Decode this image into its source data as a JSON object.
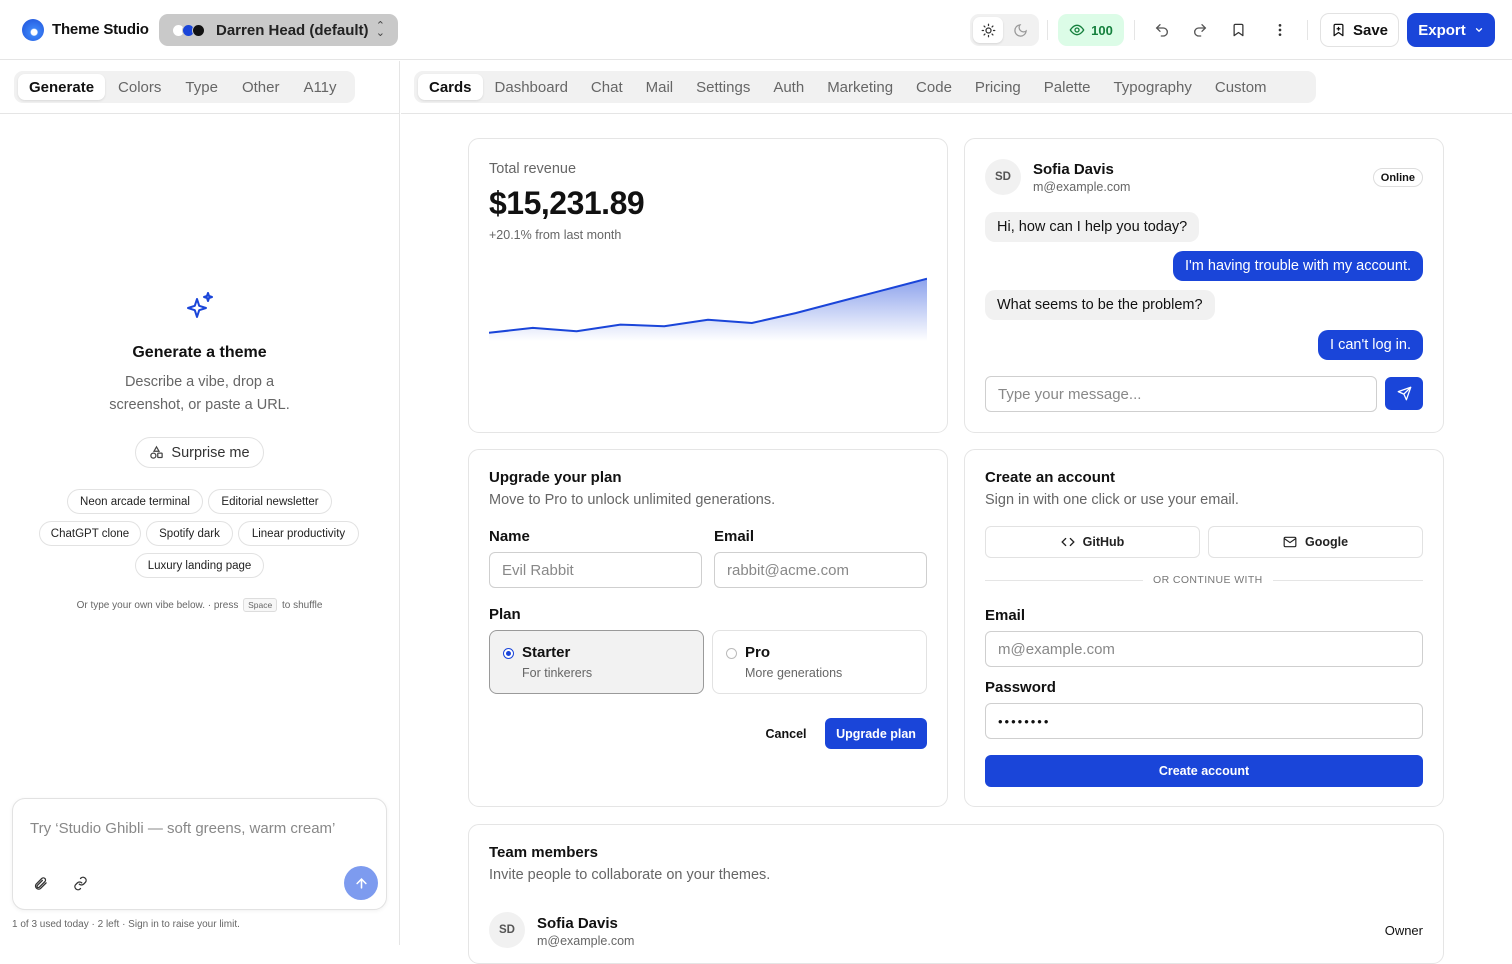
{
  "app": {
    "title": "Theme Studio"
  },
  "theme_selector": {
    "label": "Darren Head (default)",
    "swatch_colors": [
      "#ffffff",
      "#1a45d9",
      "#111111"
    ]
  },
  "header": {
    "score": "100",
    "save_label": "Save",
    "export_label": "Export",
    "icons": [
      "sun-icon",
      "moon-icon",
      "eye-icon",
      "undo-icon",
      "redo-icon",
      "bookmark-icon",
      "more-vertical-icon",
      "bookmark-plus-icon",
      "chevron-down-icon"
    ]
  },
  "left_panel": {
    "tabs": [
      "Generate",
      "Colors",
      "Type",
      "Other",
      "A11y"
    ],
    "active_tab": "Generate",
    "generate": {
      "title": "Generate a theme",
      "description": "Describe a vibe, drop a screenshot, or paste a URL.",
      "surprise_label": "Surprise me",
      "suggestions": [
        "Neon arcade terminal",
        "Editorial newsletter",
        "ChatGPT clone",
        "Spotify dark",
        "Linear productivity",
        "Luxury landing page"
      ],
      "hint_before": "Or type your own vibe below. · press",
      "hint_key": "Space",
      "hint_after": "to shuffle"
    },
    "prompt": {
      "placeholder": "Try ‘Studio Ghibli — soft greens, warm cream’"
    },
    "usage": "1 of 3 used today · 2 left · Sign in to raise your limit."
  },
  "preview_tabs": [
    "Cards",
    "Dashboard",
    "Chat",
    "Mail",
    "Settings",
    "Auth",
    "Marketing",
    "Code",
    "Pricing",
    "Palette",
    "Typography",
    "Custom"
  ],
  "active_preview_tab": "Cards",
  "revenue_card": {
    "label": "Total revenue",
    "value": "$15,231.89",
    "change": "+20.1% from last month",
    "accent": "#1a45d9"
  },
  "chart_data": {
    "type": "area",
    "x": [
      1,
      2,
      3,
      4,
      5,
      6,
      7,
      8,
      9,
      10,
      11
    ],
    "values": [
      10,
      16,
      12,
      20,
      18,
      26,
      22,
      34,
      48,
      62,
      76
    ],
    "title": "",
    "xlabel": "",
    "ylabel": "",
    "ylim": [
      0,
      100
    ],
    "grid": false
  },
  "chat_card": {
    "avatar": "SD",
    "name": "Sofia Davis",
    "email": "m@example.com",
    "status": "Online",
    "messages": [
      {
        "from": "agent",
        "text": "Hi, how can I help you today?"
      },
      {
        "from": "user",
        "text": "I'm having trouble with my account."
      },
      {
        "from": "agent",
        "text": "What seems to be the problem?"
      },
      {
        "from": "user",
        "text": "I can't log in."
      }
    ],
    "input_placeholder": "Type your message..."
  },
  "upgrade_card": {
    "title": "Upgrade your plan",
    "subtitle": "Move to Pro to unlock unlimited generations.",
    "name_label": "Name",
    "name_placeholder": "Evil Rabbit",
    "email_label": "Email",
    "email_placeholder": "rabbit@acme.com",
    "plan_label": "Plan",
    "plans": [
      {
        "name": "Starter",
        "desc": "For tinkerers",
        "selected": true
      },
      {
        "name": "Pro",
        "desc": "More generations",
        "selected": false
      }
    ],
    "cancel_label": "Cancel",
    "submit_label": "Upgrade plan"
  },
  "account_card": {
    "title": "Create an account",
    "subtitle": "Sign in with one click or use your email.",
    "github_label": "GitHub",
    "google_label": "Google",
    "divider": "OR CONTINUE WITH",
    "email_label": "Email",
    "email_placeholder": "m@example.com",
    "password_label": "Password",
    "password_value": "••••••••",
    "submit_label": "Create account"
  },
  "team_card": {
    "title": "Team members",
    "subtitle": "Invite people to collaborate on your themes.",
    "members": [
      {
        "avatar": "SD",
        "name": "Sofia Davis",
        "email": "m@example.com",
        "role": "Owner"
      }
    ]
  }
}
